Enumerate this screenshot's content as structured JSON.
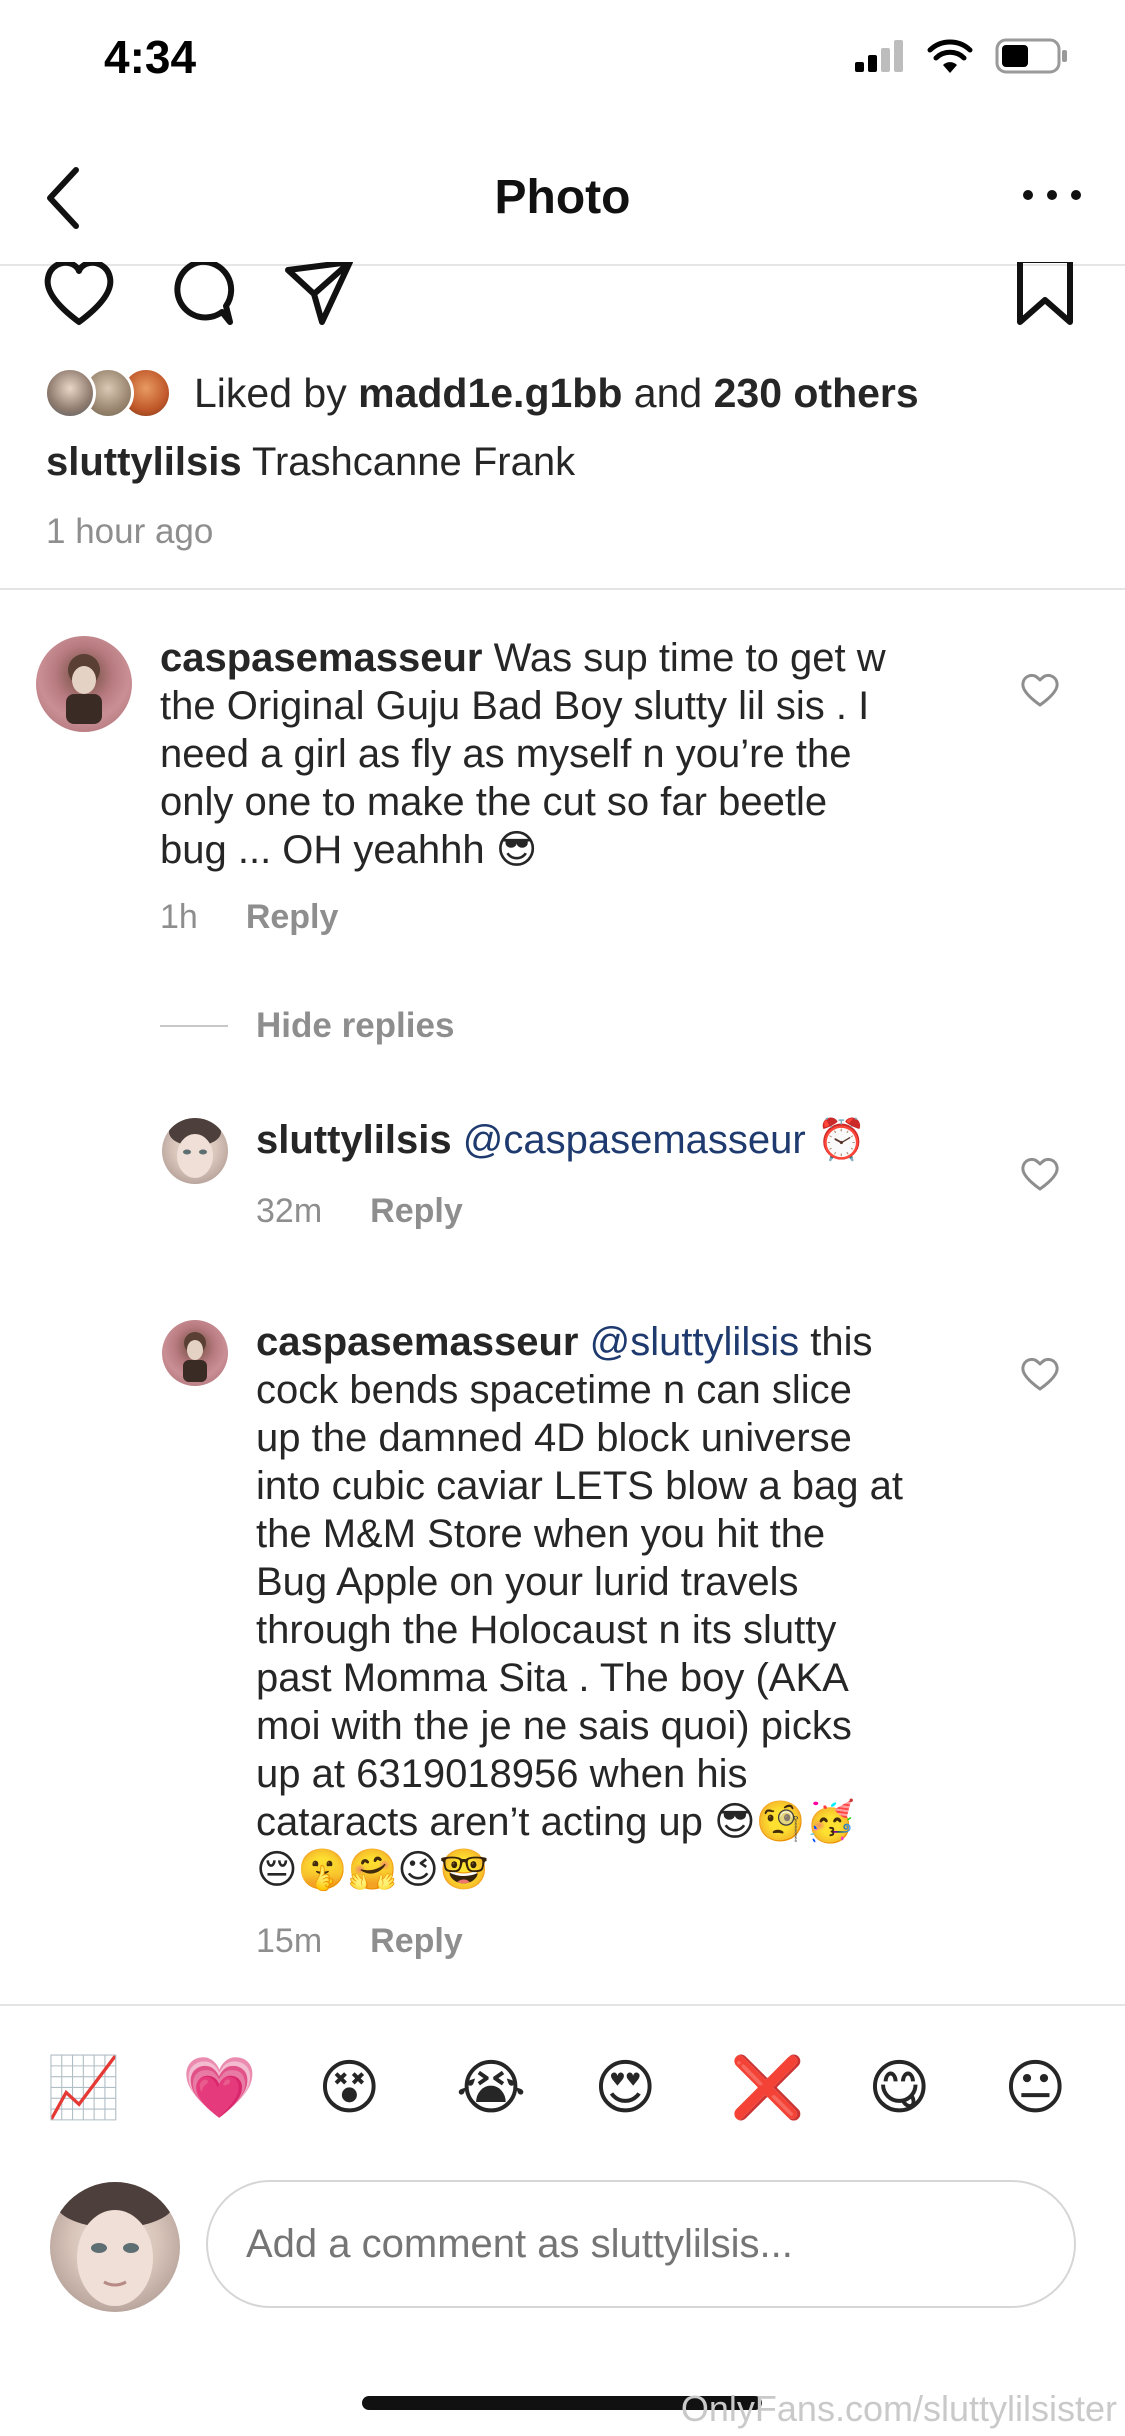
{
  "status_bar": {
    "time": "4:34"
  },
  "nav": {
    "title": "Photo"
  },
  "post": {
    "liked_prefix": "Liked by ",
    "liked_user": "madd1e.g1bb",
    "liked_and": " and ",
    "liked_others": "230 others",
    "caption_user": "sluttylilsis",
    "caption_text": " Trashcanne Frank",
    "time": "1 hour ago"
  },
  "comments": {
    "main": {
      "username": "caspasemasseur",
      "lines": [
        " Was sup time to get w",
        "the Original Guju Bad Boy slutty lil sis . I",
        "need a girl as fly as myself n you’re the",
        "only one to make the cut so far beetle",
        "bug ... OH yeahhh 😎"
      ],
      "time": "1h",
      "reply_label": "Reply"
    },
    "hide_replies_label": "Hide replies",
    "reply1": {
      "username": "sluttylilsis",
      "mention": " @caspasemasseur",
      "text": " ⏰",
      "time": "32m",
      "reply_label": "Reply"
    },
    "reply2": {
      "username": "caspasemasseur",
      "mention": " @sluttylilsis",
      "first_line_rest": " this",
      "lines": [
        "cock bends spacetime n can slice",
        "up the damned 4D block universe",
        "into cubic caviar LETS blow a bag at",
        "the M&M Store when you hit the",
        "Bug Apple on your lurid travels",
        "through the Holocaust n its slutty",
        "past Momma Sita . The boy (AKA",
        "moi with the je ne sais quoi) picks",
        "up at 6319018956 when his",
        "cataracts aren’t acting up 😎🧐🥳",
        "😔🤫🤗😉🤓"
      ],
      "time": "15m",
      "reply_label": "Reply"
    }
  },
  "quick_emojis": [
    "📈",
    "💗",
    "😵",
    "😭",
    "😍",
    "❌",
    "😋",
    "😐"
  ],
  "composer": {
    "placeholder": "Add a comment as sluttylilsis..."
  },
  "watermark": "OnlyFans.com/sluttylilsister",
  "colors": {
    "mention": "#1e3a6e",
    "secondary_text": "#8e8e8e"
  }
}
